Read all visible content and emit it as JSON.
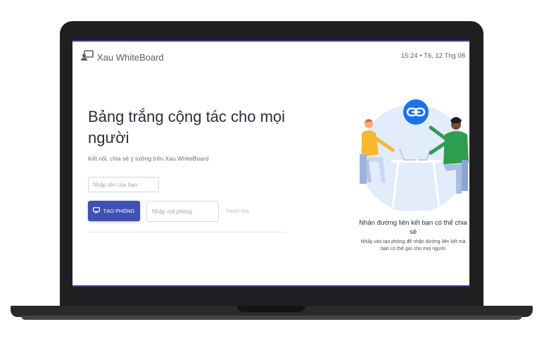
{
  "app": {
    "name": "Xau WhiteBoard",
    "datetime": "15:24 • T6, 12 Thg 08"
  },
  "hero": {
    "title": "Bảng trắng cộng tác cho mọi người",
    "subtitle": "Kết nối, chia sẻ ý tưởng trên Xau WhiteBoard"
  },
  "form": {
    "name_placeholder": "Nhập tên của bạn",
    "create_label": "TẠO PHÒNG",
    "code_placeholder": "Nhập mã phòng",
    "join_label": "THAM GIA"
  },
  "promo": {
    "title": "Nhận đường liên kết bạn có thể chia sẻ",
    "text": "Nhấp vào tạo phòng để nhận đường liên kết mà bạn có thể gửi cho mọi người"
  },
  "colors": {
    "accent": "#3f51b5",
    "illustration_bg": "#e3ecfa",
    "link_badge": "#1a73e8"
  },
  "icons": {
    "logo": "present-to-all-icon",
    "create": "whiteboard-icon",
    "link": "link-icon"
  }
}
